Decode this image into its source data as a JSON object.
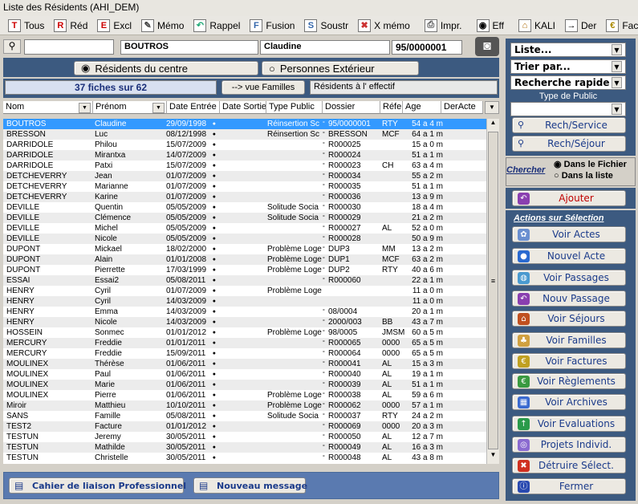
{
  "window": {
    "title": "Liste des Résidents  (AHI_DEM)"
  },
  "toolbar": [
    {
      "label": "Tous",
      "icon": "T"
    },
    {
      "label": "Réd",
      "icon": "R"
    },
    {
      "label": "Excl",
      "icon": "E"
    },
    {
      "label": "Mémo",
      "icon": "✎"
    },
    {
      "label": "Rappel",
      "icon": "↶"
    },
    {
      "label": "Fusion",
      "icon": "F"
    },
    {
      "label": "Soustr",
      "icon": "S"
    },
    {
      "label": "X mémo",
      "icon": "✖"
    },
    {
      "label": "Impr.",
      "icon": "⎙"
    },
    {
      "label": "Eff",
      "icon": "◉"
    },
    {
      "label": "KALI",
      "icon": "⌂"
    },
    {
      "label": "Der",
      "icon": "→"
    },
    {
      "label": "Fact",
      "icon": "€"
    }
  ],
  "search": {
    "value": "",
    "nom": "BOUTROS",
    "prenom": "Claudine",
    "dossier": "95/0000001"
  },
  "radio": {
    "residents": "Résidents du centre",
    "exterieurs": "Personnes Extérieur"
  },
  "info": {
    "count": "37 fiches sur 62",
    "vue_familles": "--> vue  Familles",
    "effectif": "Résidents à l' effectif"
  },
  "columns": [
    "Nom",
    "Prénom",
    "Date Entrée",
    "Date Sortie",
    "Type Public",
    "Dossier",
    "Réfe",
    "Age",
    "DerActe"
  ],
  "rows": [
    [
      "BOUTROS",
      "Claudine",
      "29/09/1998",
      "",
      "Réinsertion Sc",
      "95/0000001",
      "RTY",
      "54 a 4 m"
    ],
    [
      "BRESSON",
      "Luc",
      "08/12/1998",
      "",
      "Réinsertion Sc",
      "BRESSON",
      "MCF",
      "64 a 1 m"
    ],
    [
      "DARRIDOLE",
      "Philou",
      "15/07/2009",
      "",
      "",
      "R000025",
      "",
      "15 a 0 m"
    ],
    [
      "DARRIDOLE",
      "Mirantxa",
      "14/07/2009",
      "",
      "",
      "R000024",
      "",
      "51 a 1 m"
    ],
    [
      "DARRIDOLE",
      "Patxi",
      "15/07/2009",
      "",
      "",
      "R000023",
      "CH",
      "63 a 4 m"
    ],
    [
      "DETCHEVERRY",
      "Jean",
      "01/07/2009",
      "",
      "",
      "R000034",
      "",
      "55 a 2 m"
    ],
    [
      "DETCHEVERRY",
      "Marianne",
      "01/07/2009",
      "",
      "",
      "R000035",
      "",
      "51 a 1 m"
    ],
    [
      "DETCHEVERRY",
      "Karine",
      "01/07/2009",
      "",
      "",
      "R000036",
      "",
      "13 a 9 m"
    ],
    [
      "DEVILLE",
      "Quentin",
      "05/05/2009",
      "",
      "Solitude Socia",
      "R000030",
      "",
      "18 a 4 m"
    ],
    [
      "DEVILLE",
      "Clémence",
      "05/05/2009",
      "",
      "Solitude Socia",
      "R000029",
      "",
      "21 a 2 m"
    ],
    [
      "DEVILLE",
      "Michel",
      "05/05/2009",
      "",
      "",
      "R000027",
      "AL",
      "52 a 0 m"
    ],
    [
      "DEVILLE",
      "Nicole",
      "05/05/2009",
      "",
      "",
      "R000028",
      "",
      "50 a 9 m"
    ],
    [
      "DUPONT",
      "Mickael",
      "18/02/2000",
      "",
      "Problème Loge",
      "DUP3",
      "MM",
      "13 a 2 m"
    ],
    [
      "DUPONT",
      "Alain",
      "01/01/2008",
      "",
      "Problème Loge",
      "DUP1",
      "MCF",
      "63 a 2 m"
    ],
    [
      "DUPONT",
      "Pierrette",
      "17/03/1999",
      "",
      "Problème Loge",
      "DUP2",
      "RTY",
      "40 a 6 m"
    ],
    [
      "ESSAI",
      "Essai2",
      "05/08/2011",
      "",
      "",
      "R000060",
      "",
      "22 a 1 m"
    ],
    [
      "HENRY",
      "Cyril",
      "01/07/2009",
      "",
      "Problème Loge",
      "",
      "",
      "11 a 0 m"
    ],
    [
      "HENRY",
      "Cyril",
      "14/03/2009",
      "",
      "",
      "",
      "",
      "11 a 0 m"
    ],
    [
      "HENRY",
      "Emma",
      "14/03/2009",
      "",
      "",
      "08/0004",
      "",
      "20 a 1 m"
    ],
    [
      "HENRY",
      "Nicole",
      "14/03/2009",
      "",
      "",
      "2000/003",
      "BB",
      "43 a 7 m"
    ],
    [
      "HOSSEIN",
      "Sonmec",
      "01/01/2012",
      "",
      "Problème Loge",
      "98/0005",
      "JMSM",
      "60 a 5 m"
    ],
    [
      "MERCURY",
      "Freddie",
      "01/01/2011",
      "",
      "",
      "R000065",
      "0000",
      "65 a 5 m"
    ],
    [
      "MERCURY",
      "Freddie",
      "15/09/2011",
      "",
      "",
      "R000064",
      "0000",
      "65 a 5 m"
    ],
    [
      "MOULINEX",
      "Thérèse",
      "01/06/2011",
      "",
      "",
      "R000041",
      "AL",
      "15 a 3 m"
    ],
    [
      "MOULINEX",
      "Paul",
      "01/06/2011",
      "",
      "",
      "R000040",
      "AL",
      "19 a 1 m"
    ],
    [
      "MOULINEX",
      "Marie",
      "01/06/2011",
      "",
      "",
      "R000039",
      "AL",
      "51 a 1 m"
    ],
    [
      "MOULINEX",
      "Pierre",
      "01/06/2011",
      "",
      "Problème Loge",
      "R000038",
      "AL",
      "59 a 6 m"
    ],
    [
      "Miroir",
      "Matthieu",
      "10/10/2011",
      "",
      "Problème Loge",
      "R000062",
      "0000",
      "57 a 1 m"
    ],
    [
      "SANS",
      "Famille",
      "05/08/2011",
      "",
      "Solitude Socia",
      "R000037",
      "RTY",
      "24 a 2 m"
    ],
    [
      "TEST2",
      "Facture",
      "01/01/2012",
      "",
      "",
      "R000069",
      "0000",
      "20 a 3 m"
    ],
    [
      "TESTUN",
      "Jeremy",
      "30/05/2011",
      "",
      "",
      "R000050",
      "AL",
      "12 a 7 m"
    ],
    [
      "TESTUN",
      "Mathilde",
      "30/05/2011",
      "",
      "",
      "R000049",
      "AL",
      "16 a 3 m"
    ],
    [
      "TESTUN",
      "Christelle",
      "30/05/2011",
      "",
      "",
      "R000048",
      "AL",
      "43 a 8 m"
    ]
  ],
  "right": {
    "liste": "Liste...",
    "trier": "Trier par...",
    "recherche": "Recherche rapide",
    "type_public": "Type de Public",
    "type_value": "",
    "rech_service": "Rech/Service",
    "rech_sejour": "Rech/Séjour",
    "chercher": "Chercher",
    "dans_fichier": "Dans le Fichier",
    "dans_liste": "Dans la liste",
    "ajouter": "Ajouter",
    "actions_title": "Actions sur Sélection",
    "actions": [
      "Voir   Actes",
      "Nouvel Acte",
      "Voir Passages",
      "Nouv Passage",
      "Voir Séjours",
      "Voir Familles",
      "Voir  Factures",
      "Voir Règlements",
      "Voir Archives",
      "Voir Evaluations",
      "Projets Individ.",
      "Détruire Sélect.",
      "Fermer"
    ]
  },
  "footer": {
    "cahier": "Cahier de liaison Professionnel",
    "nouveau": "Nouveau message"
  }
}
